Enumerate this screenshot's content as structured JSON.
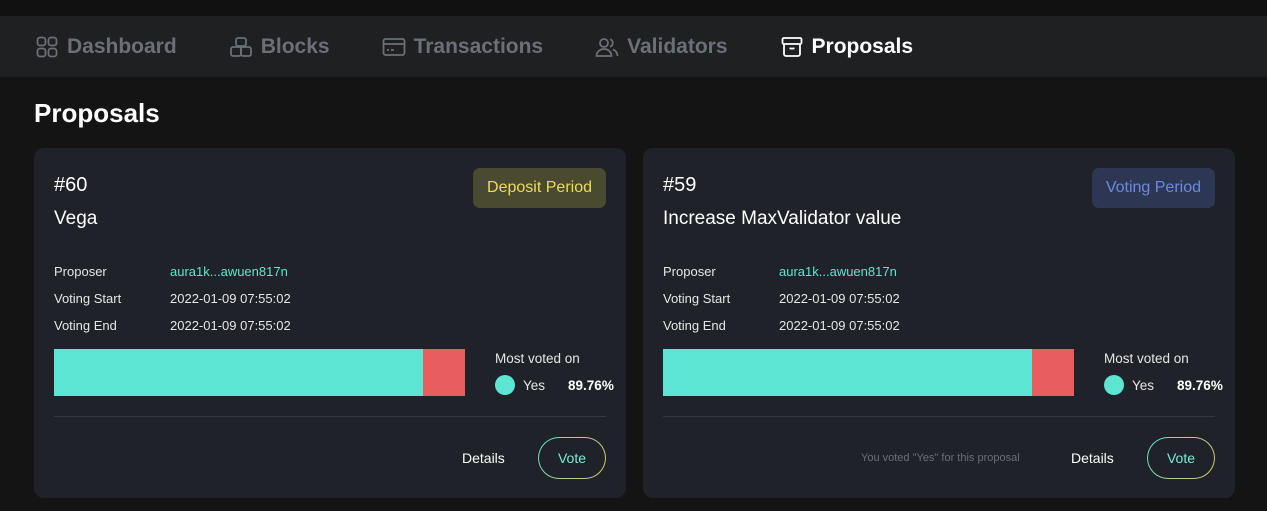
{
  "nav": {
    "items": [
      {
        "label": "Dashboard",
        "icon": "grid-icon",
        "active": false
      },
      {
        "label": "Blocks",
        "icon": "blocks-icon",
        "active": false
      },
      {
        "label": "Transactions",
        "icon": "card-icon",
        "active": false
      },
      {
        "label": "Validators",
        "icon": "users-icon",
        "active": false
      },
      {
        "label": "Proposals",
        "icon": "archive-icon",
        "active": true
      }
    ]
  },
  "page": {
    "title": "Proposals"
  },
  "proposals": [
    {
      "id": "#60",
      "title": "Vega",
      "status": "Deposit Period",
      "proposer_label": "Proposer",
      "proposer": "aura1k...awuen817n",
      "voting_start_label": "Voting Start",
      "voting_start": "2022-01-09 07:55:02",
      "voting_end_label": "Voting End",
      "voting_end": "2022-01-09 07:55:02",
      "yes_fraction": 0.8976,
      "most_voted_label": "Most voted on",
      "most_voted_option": "Yes",
      "most_voted_pct": "89.76%",
      "voted_note": "",
      "details_label": "Details",
      "vote_label": "Vote"
    },
    {
      "id": "#59",
      "title": "Increase MaxValidator value",
      "status": "Voting Period",
      "proposer_label": "Proposer",
      "proposer": "aura1k...awuen817n",
      "voting_start_label": "Voting Start",
      "voting_start": "2022-01-09 07:55:02",
      "voting_end_label": "Voting End",
      "voting_end": "2022-01-09 07:55:02",
      "yes_fraction": 0.8976,
      "most_voted_label": "Most voted on",
      "most_voted_option": "Yes",
      "most_voted_pct": "89.76%",
      "voted_note": "You voted \"Yes\" for this proposal",
      "details_label": "Details",
      "vote_label": "Vote"
    }
  ],
  "colors": {
    "accent": "#5ce6d2",
    "no": "#e85d5d",
    "deposit_badge": "#ecdd56",
    "voting_badge": "#6b8ae0"
  }
}
